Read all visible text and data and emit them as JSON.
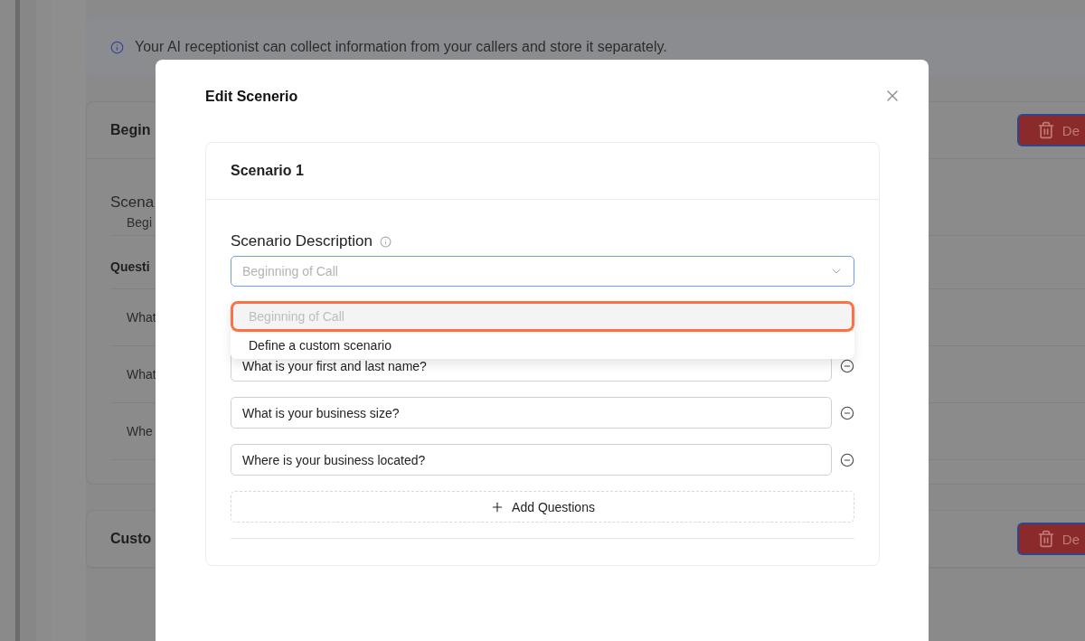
{
  "background": {
    "banner": "Your AI receptionist can collect information from your callers and store it separately.",
    "sections": [
      {
        "title": "Begin",
        "delete_label": "De",
        "scenario_label": "Scena",
        "scenario_value": "Begi",
        "questions_label": "Questi",
        "questions": [
          "What",
          "What",
          "Whe"
        ]
      },
      {
        "title": "Custo",
        "delete_label": "De"
      }
    ]
  },
  "modal": {
    "title": "Edit Scenerio",
    "scenario": {
      "title": "Scenario 1",
      "description_label": "Scenario Description",
      "select_placeholder": "Beginning of Call",
      "options": [
        {
          "label": "Beginning of Call",
          "selected": true
        },
        {
          "label": "Define a custom scenario",
          "selected": false
        }
      ],
      "questions": [
        "What is your first and last name?",
        "What is your business size?",
        "Where is your business located?"
      ],
      "add_button": "Add Questions"
    }
  }
}
